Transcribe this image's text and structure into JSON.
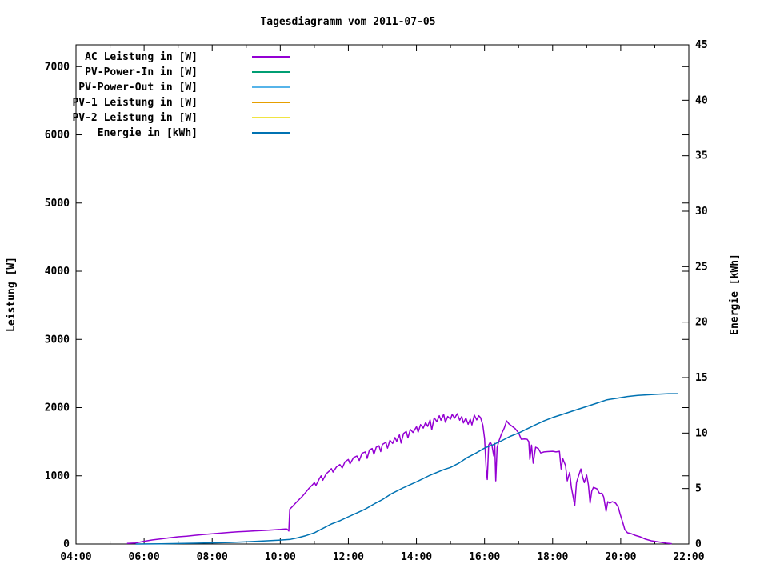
{
  "window": {
    "title": "Tagesdiagramm vom 2011-07-05"
  },
  "chart_data": {
    "type": "line",
    "title": "Tagesdiagramm vom 2011-07-05",
    "background_color": "#ffffff",
    "border_color": "#000000",
    "grid": false,
    "legend_position": "top-left",
    "x_axis": {
      "label": "",
      "unit": "time",
      "range_hours": [
        4,
        22
      ],
      "major_tick_labels": [
        "04:00",
        "06:00",
        "08:00",
        "10:00",
        "12:00",
        "14:00",
        "16:00",
        "18:00",
        "20:00",
        "22:00"
      ],
      "major_tick_hours": [
        4,
        6,
        8,
        10,
        12,
        14,
        16,
        18,
        20,
        22
      ],
      "minor_tick_hours": [
        5,
        7,
        9,
        11,
        13,
        15,
        17,
        19,
        21
      ]
    },
    "y_axis": {
      "label": "Leistung [W]",
      "range": [
        0,
        7320
      ],
      "tick_values": [
        0,
        1000,
        2000,
        3000,
        4000,
        5000,
        6000,
        7000
      ],
      "tick_labels": [
        "0",
        "1000",
        "2000",
        "3000",
        "4000",
        "5000",
        "6000",
        "7000"
      ]
    },
    "y2_axis": {
      "label": "Energie [kWh]",
      "range": [
        0,
        45
      ],
      "tick_values": [
        0,
        5,
        10,
        15,
        20,
        25,
        30,
        35,
        40,
        45
      ],
      "tick_labels": [
        "0",
        "5",
        "10",
        "15",
        "20",
        "25",
        "30",
        "35",
        "40",
        "45"
      ]
    },
    "series": [
      {
        "name": "AC Leistung in [W]",
        "color": "#9400d3",
        "axis": "y1",
        "points": [
          [
            5.5,
            8
          ],
          [
            5.75,
            15
          ],
          [
            6.0,
            40
          ],
          [
            6.25,
            60
          ],
          [
            6.5,
            75
          ],
          [
            6.75,
            90
          ],
          [
            7.0,
            105
          ],
          [
            7.25,
            115
          ],
          [
            7.5,
            128
          ],
          [
            7.75,
            140
          ],
          [
            8.0,
            150
          ],
          [
            8.25,
            160
          ],
          [
            8.5,
            170
          ],
          [
            8.75,
            178
          ],
          [
            9.0,
            185
          ],
          [
            9.25,
            192
          ],
          [
            9.5,
            198
          ],
          [
            9.75,
            205
          ],
          [
            10.0,
            213
          ],
          [
            10.15,
            220
          ],
          [
            10.2,
            218
          ],
          [
            10.25,
            190
          ],
          [
            10.28,
            510
          ],
          [
            10.35,
            545
          ],
          [
            10.45,
            600
          ],
          [
            10.55,
            650
          ],
          [
            10.65,
            700
          ],
          [
            10.75,
            760
          ],
          [
            10.85,
            820
          ],
          [
            10.95,
            870
          ],
          [
            11.0,
            900
          ],
          [
            11.05,
            860
          ],
          [
            11.15,
            960
          ],
          [
            11.2,
            1000
          ],
          [
            11.25,
            935
          ],
          [
            11.35,
            1030
          ],
          [
            11.45,
            1075
          ],
          [
            11.5,
            1105
          ],
          [
            11.55,
            1055
          ],
          [
            11.65,
            1130
          ],
          [
            11.75,
            1165
          ],
          [
            11.82,
            1115
          ],
          [
            11.9,
            1205
          ],
          [
            12.0,
            1240
          ],
          [
            12.05,
            1175
          ],
          [
            12.15,
            1265
          ],
          [
            12.25,
            1290
          ],
          [
            12.32,
            1225
          ],
          [
            12.4,
            1330
          ],
          [
            12.5,
            1350
          ],
          [
            12.55,
            1255
          ],
          [
            12.62,
            1380
          ],
          [
            12.7,
            1400
          ],
          [
            12.75,
            1315
          ],
          [
            12.82,
            1420
          ],
          [
            12.9,
            1440
          ],
          [
            12.95,
            1355
          ],
          [
            13.0,
            1460
          ],
          [
            13.1,
            1490
          ],
          [
            13.15,
            1405
          ],
          [
            13.22,
            1520
          ],
          [
            13.3,
            1475
          ],
          [
            13.37,
            1560
          ],
          [
            13.42,
            1505
          ],
          [
            13.5,
            1600
          ],
          [
            13.55,
            1480
          ],
          [
            13.62,
            1620
          ],
          [
            13.7,
            1650
          ],
          [
            13.75,
            1555
          ],
          [
            13.82,
            1680
          ],
          [
            13.9,
            1635
          ],
          [
            14.0,
            1720
          ],
          [
            14.05,
            1640
          ],
          [
            14.12,
            1750
          ],
          [
            14.2,
            1700
          ],
          [
            14.27,
            1780
          ],
          [
            14.33,
            1725
          ],
          [
            14.4,
            1820
          ],
          [
            14.45,
            1675
          ],
          [
            14.52,
            1850
          ],
          [
            14.6,
            1795
          ],
          [
            14.67,
            1880
          ],
          [
            14.72,
            1815
          ],
          [
            14.8,
            1900
          ],
          [
            14.85,
            1785
          ],
          [
            14.92,
            1870
          ],
          [
            15.0,
            1830
          ],
          [
            15.05,
            1900
          ],
          [
            15.12,
            1845
          ],
          [
            15.2,
            1910
          ],
          [
            15.27,
            1815
          ],
          [
            15.33,
            1870
          ],
          [
            15.38,
            1775
          ],
          [
            15.45,
            1845
          ],
          [
            15.52,
            1755
          ],
          [
            15.58,
            1830
          ],
          [
            15.63,
            1745
          ],
          [
            15.7,
            1890
          ],
          [
            15.77,
            1820
          ],
          [
            15.83,
            1880
          ],
          [
            15.88,
            1855
          ],
          [
            15.95,
            1745
          ],
          [
            16.0,
            1550
          ],
          [
            16.05,
            1090
          ],
          [
            16.08,
            945
          ],
          [
            16.12,
            1450
          ],
          [
            16.17,
            1495
          ],
          [
            16.22,
            1440
          ],
          [
            16.27,
            1290
          ],
          [
            16.3,
            1475
          ],
          [
            16.33,
            925
          ],
          [
            16.37,
            1415
          ],
          [
            16.42,
            1505
          ],
          [
            16.5,
            1615
          ],
          [
            16.58,
            1700
          ],
          [
            16.65,
            1805
          ],
          [
            16.72,
            1760
          ],
          [
            16.8,
            1730
          ],
          [
            16.9,
            1690
          ],
          [
            17.0,
            1630
          ],
          [
            17.08,
            1535
          ],
          [
            17.17,
            1540
          ],
          [
            17.25,
            1535
          ],
          [
            17.3,
            1500
          ],
          [
            17.33,
            1240
          ],
          [
            17.38,
            1450
          ],
          [
            17.43,
            1185
          ],
          [
            17.5,
            1420
          ],
          [
            17.58,
            1400
          ],
          [
            17.65,
            1335
          ],
          [
            17.75,
            1350
          ],
          [
            17.85,
            1355
          ],
          [
            18.0,
            1360
          ],
          [
            18.1,
            1350
          ],
          [
            18.2,
            1360
          ],
          [
            18.25,
            1100
          ],
          [
            18.3,
            1250
          ],
          [
            18.38,
            1150
          ],
          [
            18.43,
            925
          ],
          [
            18.5,
            1050
          ],
          [
            18.55,
            830
          ],
          [
            18.6,
            700
          ],
          [
            18.65,
            560
          ],
          [
            18.7,
            900
          ],
          [
            18.77,
            1010
          ],
          [
            18.83,
            1100
          ],
          [
            18.88,
            985
          ],
          [
            18.93,
            900
          ],
          [
            19.0,
            1010
          ],
          [
            19.05,
            865
          ],
          [
            19.1,
            600
          ],
          [
            19.15,
            775
          ],
          [
            19.2,
            830
          ],
          [
            19.3,
            810
          ],
          [
            19.38,
            740
          ],
          [
            19.45,
            745
          ],
          [
            19.5,
            690
          ],
          [
            19.57,
            480
          ],
          [
            19.62,
            620
          ],
          [
            19.68,
            598
          ],
          [
            19.75,
            620
          ],
          [
            19.85,
            600
          ],
          [
            19.93,
            540
          ],
          [
            19.98,
            445
          ],
          [
            20.03,
            363
          ],
          [
            20.08,
            281
          ],
          [
            20.12,
            211
          ],
          [
            20.2,
            164
          ],
          [
            20.3,
            152
          ],
          [
            20.42,
            128
          ],
          [
            20.57,
            105
          ],
          [
            20.73,
            70
          ],
          [
            20.9,
            47
          ],
          [
            21.05,
            35
          ],
          [
            21.2,
            23
          ],
          [
            21.35,
            12
          ],
          [
            21.5,
            5
          ]
        ]
      },
      {
        "name": "PV-Power-In in [W]",
        "color": "#009e73",
        "axis": "y1",
        "points": []
      },
      {
        "name": "PV-Power-Out in [W]",
        "color": "#56b4e9",
        "axis": "y1",
        "points": []
      },
      {
        "name": "PV-1 Leistung in [W]",
        "color": "#e69f00",
        "axis": "y1",
        "points": []
      },
      {
        "name": "PV-2 Leistung in [W]",
        "color": "#f0e442",
        "axis": "y1",
        "points": []
      },
      {
        "name": "Energie in [kWh]",
        "color": "#0072b2",
        "axis": "y2",
        "points": [
          [
            5.75,
            0
          ],
          [
            6.5,
            0.02
          ],
          [
            7.0,
            0.04
          ],
          [
            7.5,
            0.07
          ],
          [
            8.0,
            0.1
          ],
          [
            8.5,
            0.14
          ],
          [
            9.0,
            0.2
          ],
          [
            9.5,
            0.27
          ],
          [
            10.0,
            0.35
          ],
          [
            10.3,
            0.42
          ],
          [
            10.5,
            0.55
          ],
          [
            10.75,
            0.75
          ],
          [
            11.0,
            1.0
          ],
          [
            11.25,
            1.4
          ],
          [
            11.5,
            1.8
          ],
          [
            11.75,
            2.1
          ],
          [
            12.0,
            2.45
          ],
          [
            12.25,
            2.8
          ],
          [
            12.5,
            3.15
          ],
          [
            12.75,
            3.6
          ],
          [
            13.0,
            4.0
          ],
          [
            13.25,
            4.5
          ],
          [
            13.6,
            5.05
          ],
          [
            14.0,
            5.6
          ],
          [
            14.4,
            6.2
          ],
          [
            14.8,
            6.7
          ],
          [
            15.0,
            6.9
          ],
          [
            15.25,
            7.3
          ],
          [
            15.5,
            7.8
          ],
          [
            15.75,
            8.2
          ],
          [
            16.0,
            8.65
          ],
          [
            16.25,
            8.95
          ],
          [
            16.5,
            9.3
          ],
          [
            16.75,
            9.7
          ],
          [
            17.0,
            10.0
          ],
          [
            17.3,
            10.45
          ],
          [
            17.5,
            10.75
          ],
          [
            17.75,
            11.1
          ],
          [
            18.0,
            11.4
          ],
          [
            18.25,
            11.65
          ],
          [
            18.5,
            11.9
          ],
          [
            18.75,
            12.15
          ],
          [
            19.0,
            12.4
          ],
          [
            19.25,
            12.65
          ],
          [
            19.6,
            13.0
          ],
          [
            19.9,
            13.15
          ],
          [
            20.2,
            13.3
          ],
          [
            20.5,
            13.4
          ],
          [
            20.8,
            13.45
          ],
          [
            21.1,
            13.5
          ],
          [
            21.4,
            13.55
          ],
          [
            21.67,
            13.55
          ]
        ]
      }
    ]
  }
}
